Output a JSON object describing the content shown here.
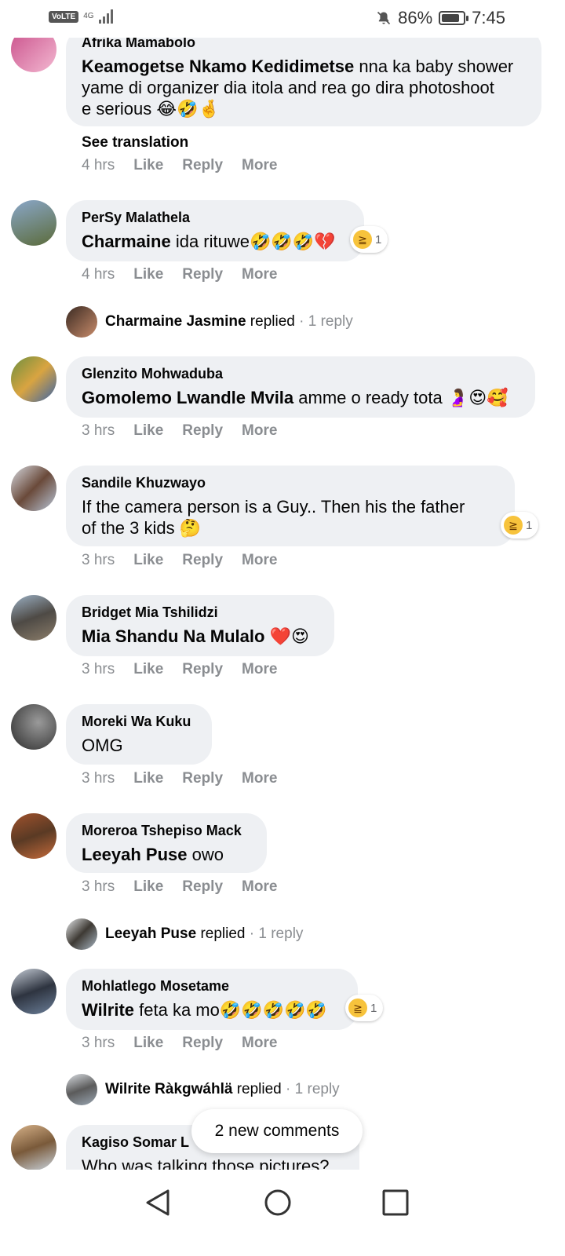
{
  "status_bar": {
    "volte": "VoLTE",
    "network": "4G",
    "battery": "86%",
    "battery_level": 0.86,
    "time": "7:45",
    "icons": [
      "signal-icon",
      "mute-bell-icon",
      "battery-saver-icon"
    ]
  },
  "comments": [
    {
      "author": "Afrika Mamabolo",
      "tag": "Keamogetse Nkamo Kedidimetse",
      "text_line1": " nna ka baby shower",
      "text_line2": "yame di organizer dia itola and rea go dira photoshoot",
      "text_line3": "e serious 😂🤣🤞",
      "see_translation": "See translation",
      "time": "4 hrs",
      "like": "Like",
      "reply": "Reply",
      "more": "More"
    },
    {
      "author": "PerSy Malathela",
      "tag": "Charmaine",
      "text": " ida rituwe🤣🤣🤣💔",
      "reaction_count": "1",
      "time": "4 hrs",
      "like": "Like",
      "reply": "Reply",
      "more": "More",
      "replied": {
        "name": "Charmaine Jasmine",
        "label": " replied",
        "count": " · 1 reply"
      }
    },
    {
      "author": "Glenzito Mohwaduba",
      "tag": "Gomolemo Lwandle Mvila",
      "text": " amme o ready tota 🤰😍🥰",
      "time": "3 hrs",
      "like": "Like",
      "reply": "Reply",
      "more": "More"
    },
    {
      "author": "Sandile Khuzwayo",
      "text_line1": "If the camera person is a Guy.. Then his the father",
      "text_line2": "of the 3 kids 🤔",
      "reaction_count": "1",
      "time": "3 hrs",
      "like": "Like",
      "reply": "Reply",
      "more": "More"
    },
    {
      "author": "Bridget Mia Tshilidzi",
      "tag": "Mia Shandu Na Mulalo",
      "text": " ❤️😍",
      "time": "3 hrs",
      "like": "Like",
      "reply": "Reply",
      "more": "More"
    },
    {
      "author": "Moreki Wa Kuku",
      "text": "OMG",
      "time": "3 hrs",
      "like": "Like",
      "reply": "Reply",
      "more": "More"
    },
    {
      "author": "Moreroa Tshepiso Mack",
      "tag": "Leeyah Puse",
      "text": " owo",
      "time": "3 hrs",
      "like": "Like",
      "reply": "Reply",
      "more": "More",
      "replied": {
        "name": "Leeyah Puse",
        "label": " replied",
        "count": " · 1 reply"
      }
    },
    {
      "author": "Mohlatlego Mosetame",
      "tag": "Wilrite",
      "text": " feta ka mo🤣🤣🤣🤣🤣",
      "reaction_count": "1",
      "time": "3 hrs",
      "like": "Like",
      "reply": "Reply",
      "more": "More",
      "replied": {
        "name": "Wilrite Ràkgwáhlä",
        "label": " replied",
        "count": " · 1 reply"
      }
    },
    {
      "author": "Kagiso Somar L",
      "text": "Who was talking those pictures?"
    }
  ],
  "new_comments_pill": "2 new comments",
  "colors": {
    "bubble": "#eef0f3",
    "muted_text": "#8a8d91",
    "text": "#050505"
  }
}
